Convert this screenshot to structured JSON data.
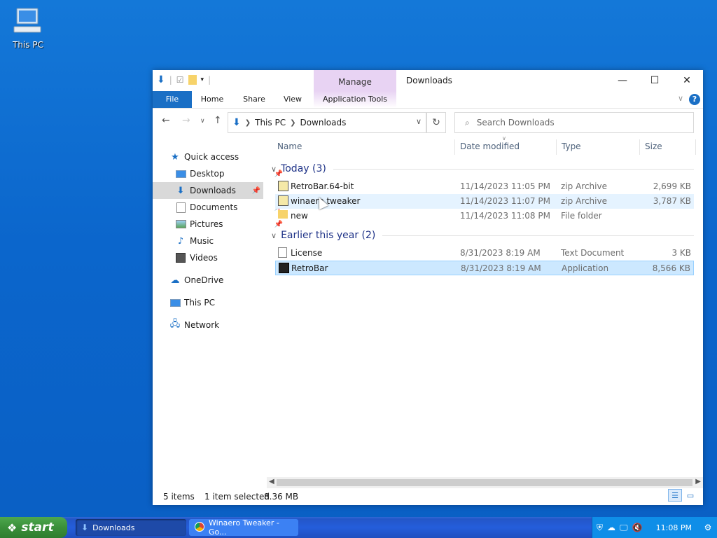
{
  "desktop": {
    "icon_label": "This PC"
  },
  "window": {
    "title": "Downloads",
    "manage_tab": "Manage",
    "ribbon_tabs": [
      "File",
      "Home",
      "Share",
      "View",
      "Application Tools"
    ],
    "help": "?",
    "address": {
      "crumbs": [
        "This PC",
        "Downloads"
      ]
    },
    "search": {
      "placeholder": "Search Downloads"
    }
  },
  "nav_pane": {
    "items": [
      {
        "label": "Quick access",
        "icon": "star-icon"
      },
      {
        "label": "Desktop",
        "icon": "desktop-icon",
        "pinned": true
      },
      {
        "label": "Downloads",
        "icon": "downloads-icon",
        "pinned": true,
        "selected": true
      },
      {
        "label": "Documents",
        "icon": "documents-icon",
        "pinned": true
      },
      {
        "label": "Pictures",
        "icon": "pictures-icon",
        "pinned": true
      },
      {
        "label": "Music",
        "icon": "music-icon"
      },
      {
        "label": "Videos",
        "icon": "videos-icon"
      },
      {
        "label": "OneDrive",
        "icon": "onedrive-icon"
      },
      {
        "label": "This PC",
        "icon": "this-pc-icon"
      },
      {
        "label": "Network",
        "icon": "network-icon"
      }
    ]
  },
  "columns": [
    "Name",
    "Date modified",
    "Type",
    "Size"
  ],
  "groups": [
    {
      "label": "Today (3)",
      "rows": [
        {
          "name": "RetroBar.64-bit",
          "date": "11/14/2023 11:05 PM",
          "type": "zip Archive",
          "size": "2,699 KB",
          "icon": "zip-icon"
        },
        {
          "name": "winaero tweaker",
          "date": "11/14/2023 11:07 PM",
          "type": "zip Archive",
          "size": "3,787 KB",
          "icon": "zip-icon",
          "hover": true
        },
        {
          "name": "new",
          "date": "11/14/2023 11:08 PM",
          "type": "File folder",
          "size": "",
          "icon": "folder-icon"
        }
      ]
    },
    {
      "label": "Earlier this year (2)",
      "rows": [
        {
          "name": "License",
          "date": "8/31/2023 8:19 AM",
          "type": "Text Document",
          "size": "3 KB",
          "icon": "text-file-icon"
        },
        {
          "name": "RetroBar",
          "date": "8/31/2023 8:19 AM",
          "type": "Application",
          "size": "8,566 KB",
          "icon": "application-icon",
          "selected": true
        }
      ]
    }
  ],
  "status": {
    "items": "5 items",
    "selection": "1 item selected",
    "size": "8.36 MB"
  },
  "taskbar": {
    "start": "start",
    "buttons": [
      {
        "label": "Downloads",
        "active": true
      },
      {
        "label": "Winaero Tweaker - Go..."
      }
    ],
    "clock": "11:08 PM"
  },
  "colors": {
    "accent": "#1a6fc5",
    "manage_tab": "#e8d3f3",
    "selection": "#cce8ff",
    "hover": "#e5f3ff"
  }
}
